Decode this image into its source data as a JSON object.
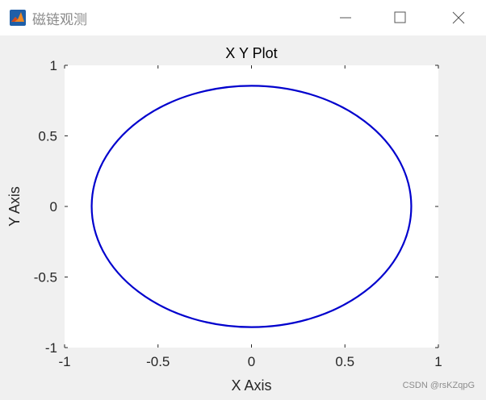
{
  "window": {
    "title": "磁链观测",
    "icon": "matlab-icon",
    "controls": {
      "minimize": "minimize-icon",
      "maximize": "maximize-icon",
      "close": "close-icon"
    }
  },
  "chart_data": {
    "type": "line",
    "title": "X Y Plot",
    "xlabel": "X Axis",
    "ylabel": "Y Axis",
    "xlim": [
      -1,
      1
    ],
    "ylim": [
      -1,
      1
    ],
    "xticks": [
      "-1",
      "-0.5",
      "0",
      "0.5",
      "1"
    ],
    "yticks": [
      "1",
      "0.5",
      "0",
      "-0.5",
      "-1"
    ],
    "grid": false,
    "series": [
      {
        "color": "#0000cd",
        "shape": "closed-ellipse",
        "center": [
          0,
          0
        ],
        "radius_x": 0.855,
        "radius_y": 0.855
      }
    ]
  },
  "watermark": "CSDN @rsKZqpG"
}
